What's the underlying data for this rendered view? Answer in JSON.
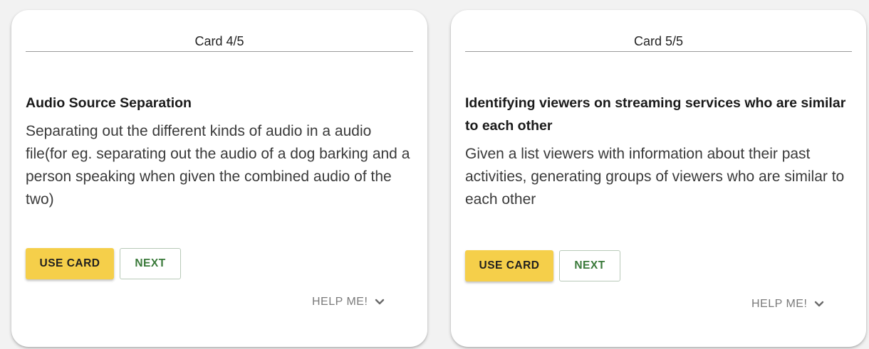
{
  "cards": [
    {
      "header": "Card 4/5",
      "title": "Audio Source Separation",
      "description": "Separating out the different kinds of audio in a audio file(for eg. separating out the audio of a dog barking and a person speaking when given the combined audio of the two)",
      "use_label": "USE CARD",
      "next_label": "NEXT",
      "help_label": "HELP ME!",
      "help_icon": "chevron-down-icon"
    },
    {
      "header": "Card 5/5",
      "title": "Identifying viewers on streaming services who are similar to each other",
      "description": "Given a list viewers with information about their past activities, generating groups of viewers who are similar to each other",
      "use_label": "USE CARD",
      "next_label": "NEXT",
      "help_label": "HELP ME!",
      "help_icon": "chevron-down-icon"
    }
  ],
  "colors": {
    "use_button": "#f5cf4a",
    "next_text": "#3a7a3a",
    "help_text": "#7a7a7a"
  }
}
